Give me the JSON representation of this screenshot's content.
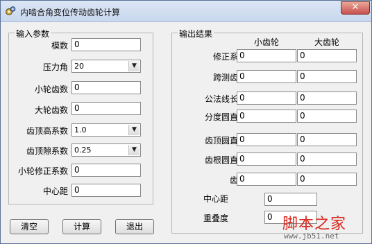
{
  "window": {
    "title": "内啮合角变位传动齿轮计算",
    "close_glyph": "✕"
  },
  "input_group": {
    "title": "输入参数",
    "module_label": "模数",
    "module_value": "0",
    "pressure_angle_label": "压力角",
    "pressure_angle_value": "20",
    "pinion_teeth_label": "小轮齿数",
    "pinion_teeth_value": "0",
    "gear_teeth_label": "大轮齿数",
    "gear_teeth_value": "0",
    "addendum_coef_label": "齿顶高系数",
    "addendum_coef_value": "1.0",
    "clearance_coef_label": "齿顶隙系数",
    "clearance_coef_value": "0.25",
    "pinion_shift_label": "小轮修正系数",
    "pinion_shift_value": "0",
    "center_distance_label": "中心距",
    "center_distance_value": "0"
  },
  "output_group": {
    "title": "输出结果",
    "col_small": "小齿轮",
    "col_large": "大齿轮",
    "rows": [
      {
        "label": "修正系数",
        "small": "0",
        "large": "0"
      },
      {
        "label": "跨测齿数",
        "small": "0",
        "large": "0"
      },
      {
        "label": "公法线长度",
        "small": "0",
        "large": "0"
      },
      {
        "label": "分度圆直径",
        "small": "0",
        "large": "0"
      },
      {
        "label": "齿顶圆直径",
        "small": "0",
        "large": "0"
      },
      {
        "label": "齿根圆直径",
        "small": "0",
        "large": "0"
      },
      {
        "label": "齿数",
        "small": "0",
        "large": "0"
      }
    ],
    "center_distance_label": "中心距",
    "center_distance_value": "0",
    "overlap_label": "重叠度",
    "overlap_value": "0"
  },
  "buttons": {
    "clear": "清空",
    "calculate": "计算",
    "exit": "退出"
  },
  "watermark": {
    "text": "脚本之家",
    "url": "www.jb51.net"
  },
  "colors": {
    "title_bar": "#c9d8ee",
    "close_button": "#c75050",
    "watermark": "#d9261c"
  },
  "icons": {
    "app": "gear-icon",
    "dropdown": "chevron-down-icon",
    "close": "close-icon"
  }
}
